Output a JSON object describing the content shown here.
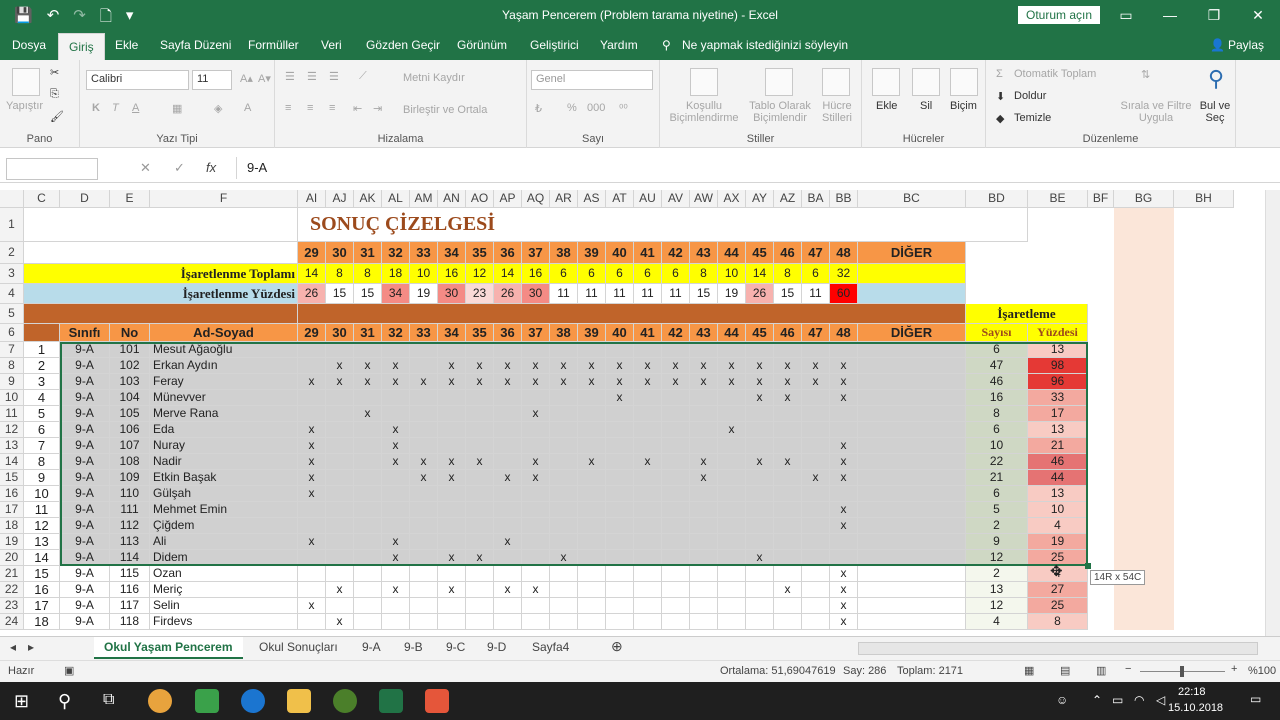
{
  "window": {
    "title": "Yaşam Pencerem (Problem tarama niyetine)  -  Excel",
    "signin": "Oturum açın"
  },
  "ribbon_tabs": [
    "Dosya",
    "Giriş",
    "Ekle",
    "Sayfa Düzeni",
    "Formüller",
    "Veri",
    "Gözden Geçir",
    "Görünüm",
    "Geliştirici",
    "Yardım"
  ],
  "tell_me": "Ne yapmak istediğinizi söyleyin",
  "share": "Paylaş",
  "ribbon": {
    "pano": {
      "label": "Pano",
      "paste": "Yapıştır"
    },
    "font": {
      "label": "Yazı Tipi",
      "name": "Calibri",
      "size": "11",
      "bold": "K",
      "italic": "T",
      "underline": "A"
    },
    "align": {
      "label": "Hizalama",
      "wrap": "Metni Kaydır",
      "merge": "Birleştir ve Ortala"
    },
    "number": {
      "label": "Sayı",
      "format": "Genel",
      "percent": "%",
      "comma": "000"
    },
    "styles": {
      "label": "Stiller",
      "cond": "Koşullu Biçimlendirme",
      "table": "Tablo Olarak Biçimlendir",
      "cell": "Hücre Stilleri"
    },
    "cells": {
      "label": "Hücreler",
      "insert": "Ekle",
      "delete": "Sil",
      "format": "Biçim"
    },
    "editing": {
      "label": "Düzenleme",
      "autosum": "Otomatik Toplam",
      "fill": "Doldur",
      "clear": "Temizle",
      "sort": "Sırala ve Filtre Uygula",
      "find": "Bul ve Seç"
    }
  },
  "formula": {
    "value": "9-A",
    "fx": "fx"
  },
  "col_headers": [
    "C",
    "D",
    "E",
    "F",
    "AI",
    "AJ",
    "AK",
    "AL",
    "AM",
    "AN",
    "AO",
    "AP",
    "AQ",
    "AR",
    "AS",
    "AT",
    "AU",
    "AV",
    "AW",
    "AX",
    "AY",
    "AZ",
    "BA",
    "BB",
    "BC",
    "BD",
    "BE",
    "BF",
    "BG",
    "BH"
  ],
  "sheet": {
    "title": "SONUÇ ÇİZELGESİ",
    "questions": [
      "29",
      "30",
      "31",
      "32",
      "33",
      "34",
      "35",
      "36",
      "37",
      "38",
      "39",
      "40",
      "41",
      "42",
      "43",
      "44",
      "45",
      "46",
      "47",
      "48"
    ],
    "other": "DİĞER",
    "mark_total_label": "İşaretlenme Toplamı",
    "mark_totals": [
      "14",
      "8",
      "8",
      "18",
      "10",
      "16",
      "12",
      "14",
      "16",
      "6",
      "6",
      "6",
      "6",
      "6",
      "8",
      "10",
      "14",
      "8",
      "6",
      "32"
    ],
    "mark_pct_label": "İşaretlenme Yüzdesi",
    "mark_pcts": [
      "26",
      "15",
      "15",
      "34",
      "19",
      "30",
      "23",
      "26",
      "30",
      "11",
      "11",
      "11",
      "11",
      "11",
      "15",
      "19",
      "26",
      "15",
      "11",
      "60"
    ],
    "isaretleme": "İşaretleme",
    "h_sinif": "Sınıfı",
    "h_no": "No",
    "h_name": "Ad-Soyad",
    "h_sayisi": "Sayısı",
    "h_yuzdesi": "Yüzdesi",
    "students": [
      {
        "n": "1",
        "cls": "9-A",
        "no": "101",
        "name": "Mesut Ağaoğlu",
        "marks": "",
        "count": "6",
        "pct": "13"
      },
      {
        "n": "2",
        "cls": "9-A",
        "no": "102",
        "name": "Erkan Aydın",
        "marks": "01110111111111111111",
        "count": "47",
        "pct": "98"
      },
      {
        "n": "3",
        "cls": "9-A",
        "no": "103",
        "name": "Feray",
        "marks": "11111111111111111111",
        "count": "46",
        "pct": "96"
      },
      {
        "n": "4",
        "cls": "9-A",
        "no": "104",
        "name": "Münevver",
        "marks": "00000000000100001101",
        "count": "16",
        "pct": "33"
      },
      {
        "n": "5",
        "cls": "9-A",
        "no": "105",
        "name": "Merve Rana",
        "marks": "00100000100000000000",
        "count": "8",
        "pct": "17"
      },
      {
        "n": "6",
        "cls": "9-A",
        "no": "106",
        "name": "Eda",
        "marks": "10010000000000010000",
        "count": "6",
        "pct": "13"
      },
      {
        "n": "7",
        "cls": "9-A",
        "no": "107",
        "name": "Nuray",
        "marks": "10010000000000000001",
        "count": "10",
        "pct": "21"
      },
      {
        "n": "8",
        "cls": "9-A",
        "no": "108",
        "name": "Nadir",
        "marks": "10011110101010101101",
        "count": "22",
        "pct": "46"
      },
      {
        "n": "9",
        "cls": "9-A",
        "no": "109",
        "name": "Etkin Başak",
        "marks": "10001101100000100011",
        "count": "21",
        "pct": "44"
      },
      {
        "n": "10",
        "cls": "9-A",
        "no": "110",
        "name": "Gülşah",
        "marks": "10000000000000000000",
        "count": "6",
        "pct": "13"
      },
      {
        "n": "11",
        "cls": "9-A",
        "no": "111",
        "name": "Mehmet Emin",
        "marks": "00000000000000000001",
        "count": "5",
        "pct": "10"
      },
      {
        "n": "12",
        "cls": "9-A",
        "no": "112",
        "name": "Çiğdem",
        "marks": "00000000000000000001",
        "count": "2",
        "pct": "4"
      },
      {
        "n": "13",
        "cls": "9-A",
        "no": "113",
        "name": "Ali",
        "marks": "10010001000000000000",
        "count": "9",
        "pct": "19"
      },
      {
        "n": "14",
        "cls": "9-A",
        "no": "114",
        "name": "Didem",
        "marks": "00010110010000001000",
        "count": "12",
        "pct": "25"
      },
      {
        "n": "15",
        "cls": "9-A",
        "no": "115",
        "name": "Ozan",
        "marks": "00000000000000000001",
        "count": "2",
        "pct": "4"
      },
      {
        "n": "16",
        "cls": "9-A",
        "no": "116",
        "name": "Meriç",
        "marks": "01010101100000000101",
        "count": "13",
        "pct": "27"
      },
      {
        "n": "17",
        "cls": "9-A",
        "no": "117",
        "name": "Selin",
        "marks": "10000000000000000001",
        "count": "12",
        "pct": "25"
      },
      {
        "n": "18",
        "cls": "9-A",
        "no": "118",
        "name": "Firdevs",
        "marks": "01000000000000000001",
        "count": "4",
        "pct": "8"
      }
    ],
    "tooltip": "14R x 54C"
  },
  "sheet_tabs": [
    "Okul Yaşam Pencerem",
    "Okul Sonuçları",
    "9-A",
    "9-B",
    "9-C",
    "9-D",
    "Sayfa4"
  ],
  "status": {
    "ready": "Hazır",
    "avg": "Ortalama: 51,69047619",
    "count": "Say: 286",
    "sum": "Toplam: 2171",
    "zoom": "%100"
  },
  "taskbar": {
    "time": "22:18",
    "date": "15.10.2018"
  },
  "colors": {
    "excel_green": "#217346",
    "orange": "#f79646",
    "yellow": "#ffff00",
    "lightblue": "#b8dcea",
    "brown": "#c0642a",
    "title_brown": "#9c4a1c",
    "selected_gray": "#d0d0d0",
    "bg_peach": "#fbe6d9"
  }
}
